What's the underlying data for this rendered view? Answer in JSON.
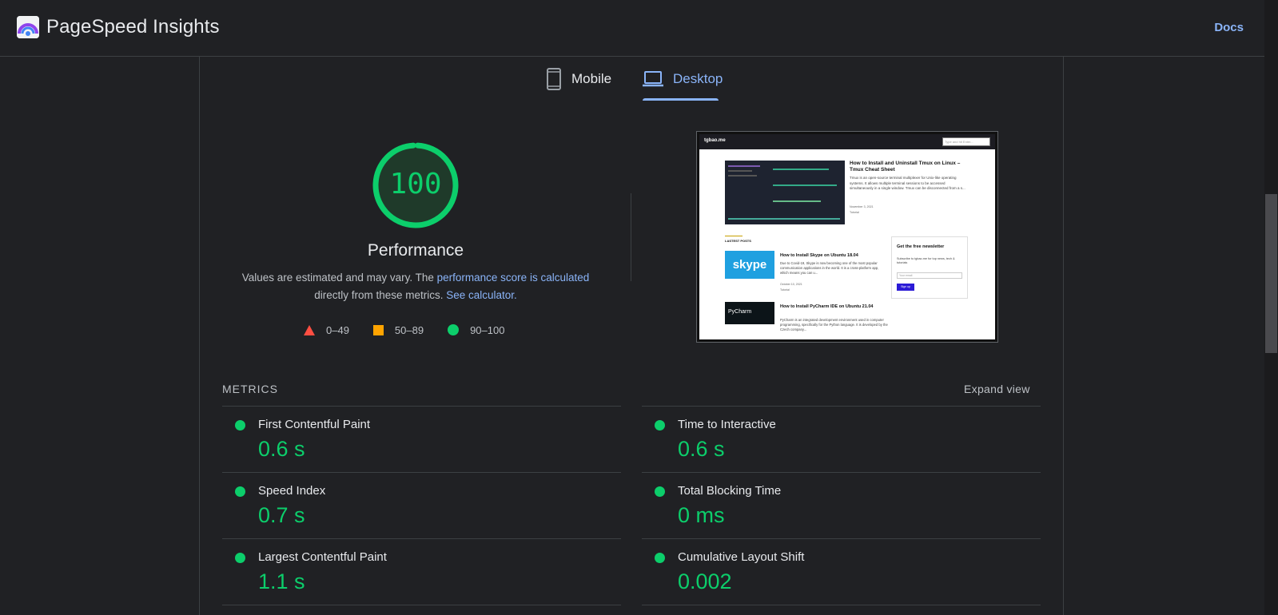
{
  "header": {
    "app_title": "PageSpeed Insights",
    "docs_label": "Docs",
    "logo_icon": "pagespeed-logo-icon"
  },
  "tabs": [
    {
      "label": "Mobile",
      "icon": "phone-icon",
      "selected": false
    },
    {
      "label": "Desktop",
      "icon": "laptop-icon",
      "selected": true
    }
  ],
  "performance": {
    "score": "100",
    "score_value": 100,
    "label": "Performance",
    "desc_prefix": "Values are estimated and may vary. The ",
    "desc_link1": "performance score is calculated",
    "desc_middle": "directly from these metrics. ",
    "desc_link2": "See calculator.",
    "legend": [
      {
        "label": "0–49",
        "shape": "triangle",
        "color": "#ff4e42"
      },
      {
        "label": "50–89",
        "shape": "square",
        "color": "#ffa400"
      },
      {
        "label": "90–100",
        "shape": "circle",
        "color": "#0cce6b"
      }
    ]
  },
  "thumbnail": {
    "site": "tgbao.me",
    "search_placeholder": "Type and hit Enter...",
    "hero_title": "How to Install and Uninstall Tmux on Linux – Tmux Cheat Sheet",
    "hero_text": "Tmux is an open-source terminal multiplexer for Unix-like operating systems. It allows multiple terminal sessions to be accessed simultaneously in a single window. Tmux can be disconnected from a s...",
    "hero_date": "November 3, 2021",
    "hero_tag": "Tutorial",
    "latest_label": "LASTEST POSTS",
    "post1_img": "skype",
    "post1_title": "How to Install Skype on Ubuntu 18.04",
    "post1_text": "Due to Covid-19, Skype is now becoming one of the most popular communication applications in the world. It is a cross-platform app, which means you can u...",
    "post1_date": "October 10, 2021",
    "post1_tag": "Tutorial",
    "post2_img": "PyCharm",
    "post2_title": "How to Install PyCharm IDE on Ubuntu 21.04",
    "post2_text": "PyCharm is an integrated development environment used in computer programming, specifically for the Python language. It is developed by the Czech company...",
    "news_title": "Get the free newsletter",
    "news_text": "Subscribe to tgbao.me for top news, tech & tutorials",
    "news_placeholder": "Your email",
    "news_button": "Sign up"
  },
  "metrics": {
    "header": "METRICS",
    "expand_label": "Expand view",
    "items": [
      {
        "name": "First Contentful Paint",
        "value": "0.6 s",
        "status": "good"
      },
      {
        "name": "Time to Interactive",
        "value": "0.6 s",
        "status": "good"
      },
      {
        "name": "Speed Index",
        "value": "0.7 s",
        "status": "good"
      },
      {
        "name": "Total Blocking Time",
        "value": "0 ms",
        "status": "good"
      },
      {
        "name": "Largest Contentful Paint",
        "value": "1.1 s",
        "status": "good"
      },
      {
        "name": "Cumulative Layout Shift",
        "value": "0.002",
        "status": "good"
      }
    ]
  },
  "colors": {
    "good": "#0cce6b",
    "link": "#8ab4f8",
    "background": "#202124"
  }
}
